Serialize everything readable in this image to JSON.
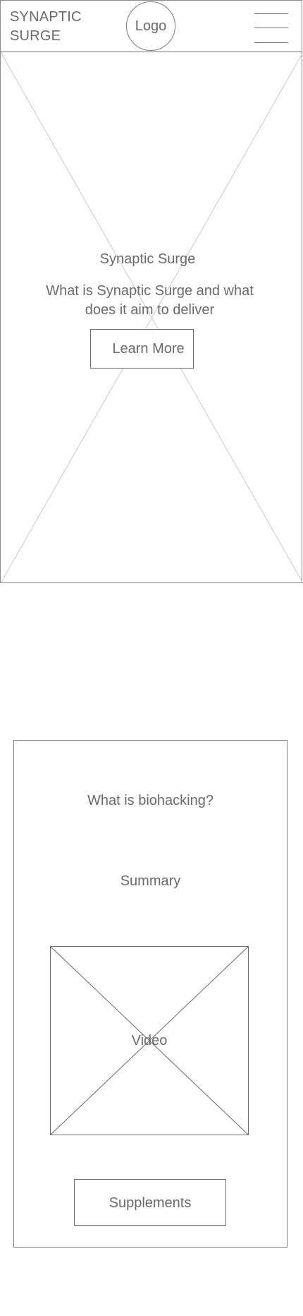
{
  "header": {
    "brand_line1": "SYNAPTIC",
    "brand_line2": "SURGE",
    "logo_label": "Logo",
    "menu_icon": "hamburger-menu-icon"
  },
  "hero": {
    "image_placeholder_icon": "image-placeholder-cross",
    "title": "Synaptic Surge",
    "subtitle": "What is Synaptic Surge and what does it aim to deliver",
    "cta_label": "Learn More"
  },
  "biohacking": {
    "title": "What is biohacking?",
    "summary": "Summary",
    "video_label": "Video",
    "video_placeholder_icon": "video-placeholder-cross",
    "supplements_label": "Supplements"
  },
  "colors": {
    "line": "#6a6a6a",
    "light_line": "#c8c8c8",
    "text": "#6a6a6a",
    "background": "#ffffff"
  }
}
